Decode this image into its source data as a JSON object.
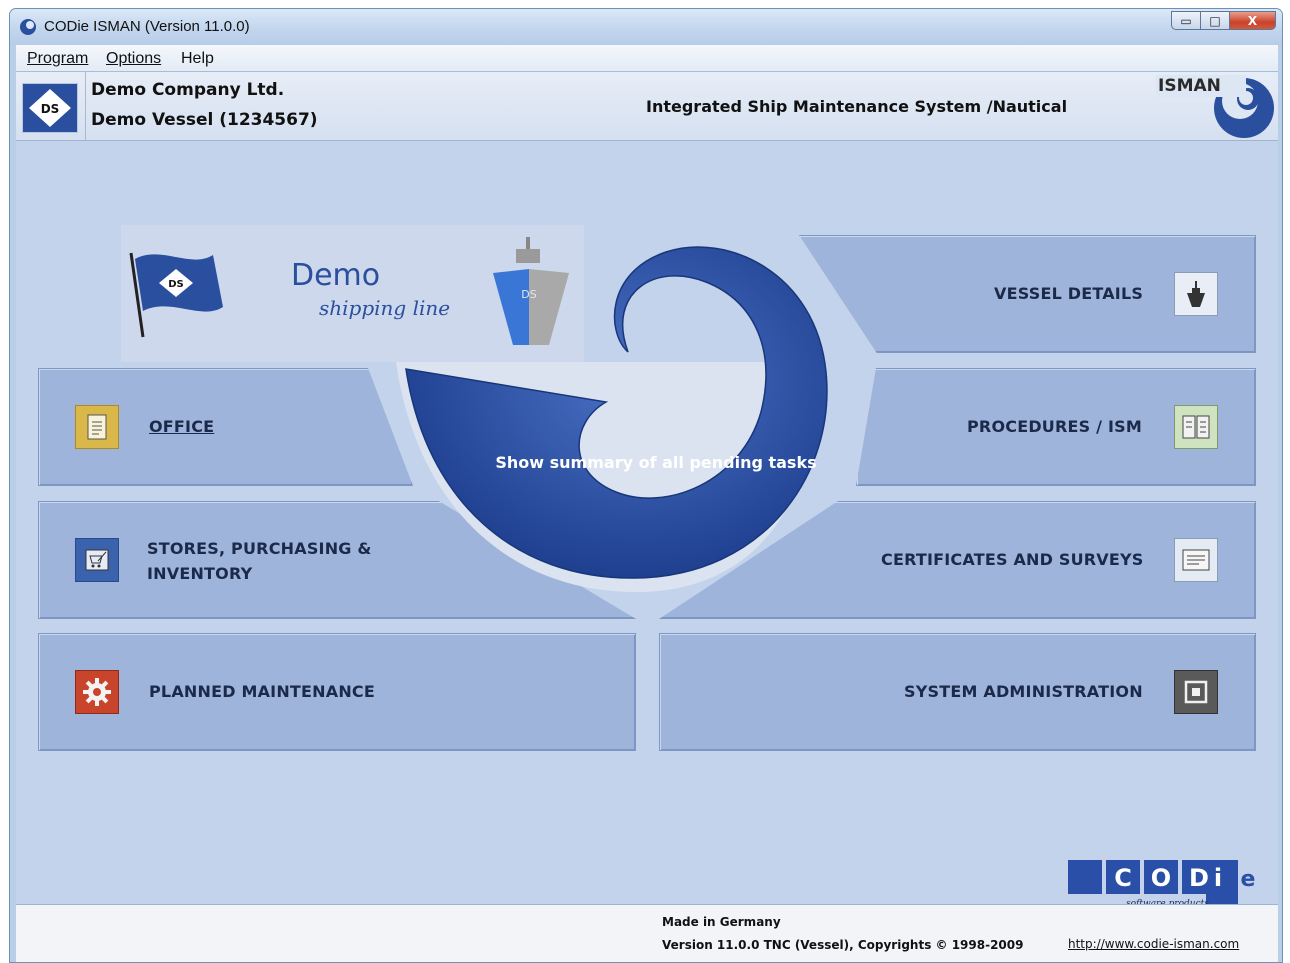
{
  "window": {
    "title": "CODie ISMAN (Version 11.0.0)",
    "minimize_glyph": "▭",
    "maximize_glyph": "□",
    "close_glyph": "X"
  },
  "menu": [
    {
      "label": "Program"
    },
    {
      "label": "Options"
    },
    {
      "label": "Help"
    }
  ],
  "header": {
    "company": "Demo Company Ltd.",
    "vessel": "Demo Vessel (1234567)",
    "system_name": "Integrated Ship Maintenance System  /Nautical",
    "logo_text": "DS",
    "isman_text": "ISMAN"
  },
  "banner": {
    "title": "Demo",
    "subtitle": "shipping line",
    "flag_text": "DS",
    "ship_text": "DS"
  },
  "center_button": {
    "label": "Show summary of all pending tasks"
  },
  "tiles": {
    "vessel_details": {
      "label": "VESSEL DETAILS",
      "icon": "ship-icon"
    },
    "office": {
      "label": "OFFICE",
      "icon": "document-icon"
    },
    "procedures": {
      "label": "PROCEDURES / ISM",
      "icon": "book-icon"
    },
    "stores": {
      "label_line1": "STORES, PURCHASING &",
      "label_line2": "INVENTORY",
      "icon": "cart-icon"
    },
    "certificates": {
      "label": "CERTIFICATES AND SURVEYS",
      "icon": "certificate-icon"
    },
    "planned_maintenance": {
      "label": "PLANNED MAINTENANCE",
      "icon": "gear-icon"
    },
    "system_administration": {
      "label": "SYSTEM ADMINISTRATION",
      "icon": "admin-icon"
    }
  },
  "footer": {
    "made_in": "Made in Germany",
    "version": "Version 11.0.0 TNC  (Vessel), Copyrights © 1998-2009",
    "url": "http://www.codie-isman.com",
    "codie_letters": [
      "C",
      "O",
      "D",
      "i",
      "e"
    ],
    "codie_tagline": "software products"
  },
  "colors": {
    "accent_blue": "#2a4f9e",
    "tile_bg": "#9fb4da",
    "client_bg": "#c4d3ec",
    "gear_red": "#c8452c"
  }
}
